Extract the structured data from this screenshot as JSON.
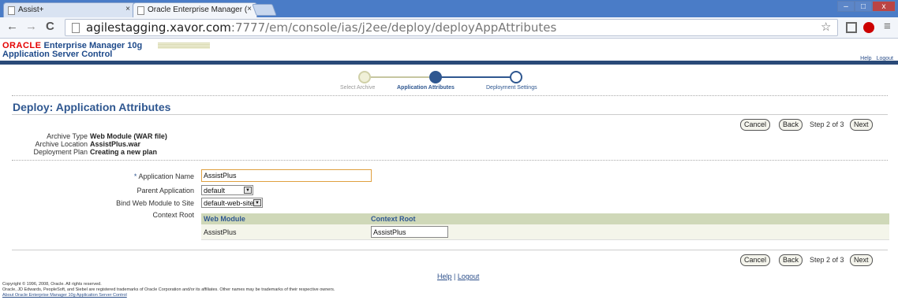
{
  "browser": {
    "tabs": [
      {
        "title": "Assist+",
        "close": "×"
      },
      {
        "title": "Oracle Enterprise Manager (",
        "close": "×"
      }
    ],
    "window_controls": {
      "min": "–",
      "max": "□",
      "close": "x"
    },
    "url_host": "agilestagging.xavor.com",
    "url_path": ":7777/em/console/ias/j2ee/deploy/deployAppAttributes",
    "icons": {
      "back": "←",
      "forward": "→",
      "reload": "C",
      "star": "☆",
      "menu": "≡"
    }
  },
  "header": {
    "oracle": "ORACLE",
    "product": "Enterprise Manager 10g",
    "subtitle": "Application Server Control",
    "help": "Help",
    "logout": "Logout"
  },
  "train": {
    "steps": [
      "Select Archive",
      "Application Attributes",
      "Deployment Settings"
    ]
  },
  "page": {
    "title": "Deploy: Application Attributes",
    "cancel": "Cancel",
    "back": "Back",
    "step": "Step 2 of 3",
    "next": "Next"
  },
  "archive_info": [
    {
      "label": "Archive Type",
      "value": "Web Module (WAR file)"
    },
    {
      "label": "Archive Location",
      "value": "AssistPlus.war"
    },
    {
      "label": "Deployment Plan",
      "value": "Creating a new plan"
    }
  ],
  "form": {
    "app_name_label": "Application Name",
    "required_marker": "*",
    "app_name_value": "AssistPlus",
    "parent_label": "Parent Application",
    "parent_value": "default",
    "bind_label": "Bind Web Module to Site",
    "bind_value": "default-web-site",
    "context_root_label": "Context Root"
  },
  "context_table": {
    "headers": [
      "Web Module",
      "Context Root"
    ],
    "rows": [
      {
        "module": "AssistPlus",
        "context_root": "AssistPlus"
      }
    ]
  },
  "footer": {
    "help": "Help",
    "separator": "|",
    "logout": "Logout",
    "copyright": "Copyright © 1996, 2008, Oracle. All rights reserved.",
    "trademarks": "Oracle, JD Edwards, PeopleSoft, and Siebel are registered trademarks of Oracle Corporation and/or its affiliates. Other names may be trademarks of their respective owners.",
    "about": "About Oracle Enterprise Manager 10g Application Server Control"
  }
}
